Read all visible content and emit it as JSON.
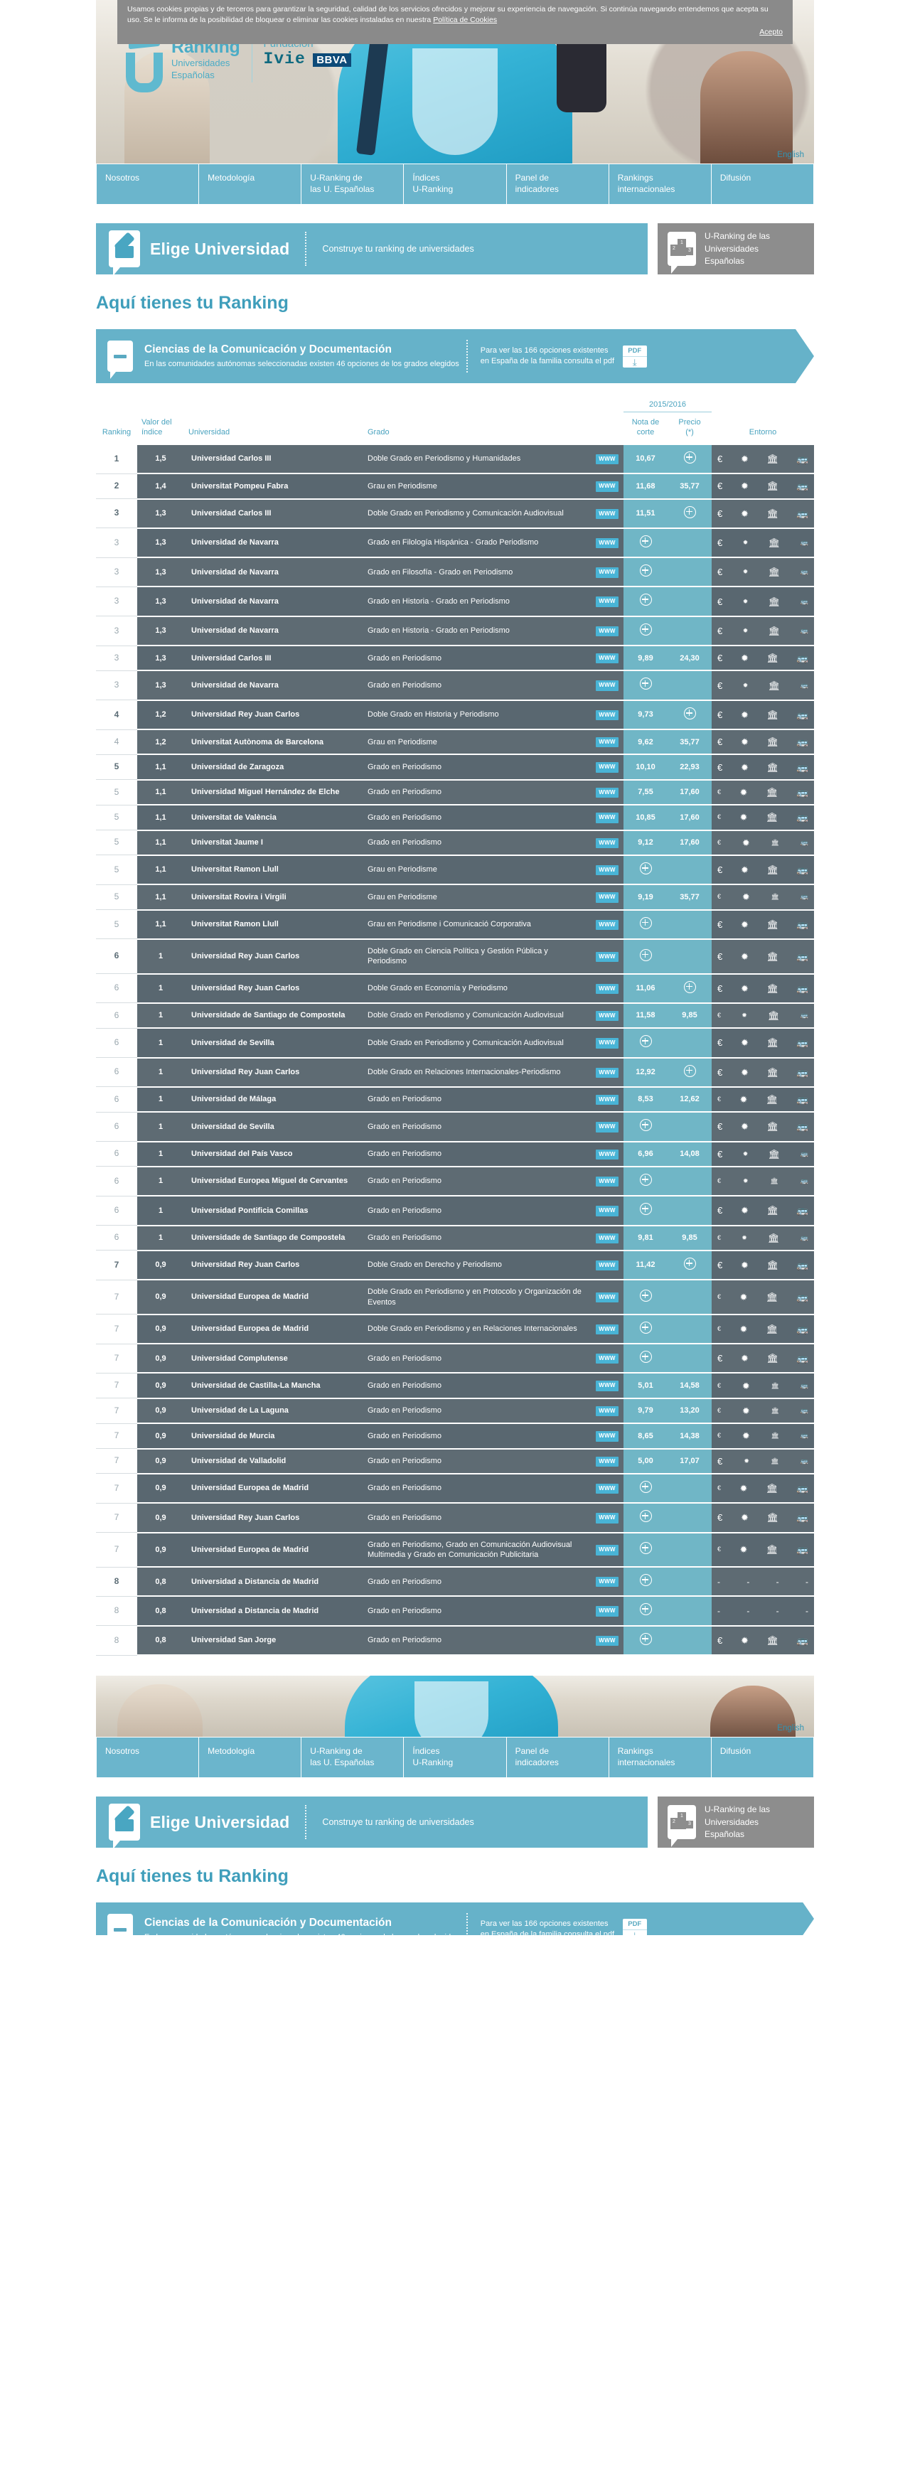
{
  "cookie": {
    "text": "Usamos cookies propias y de terceros para garantizar la seguridad, calidad de los servicios ofrecidos y mejorar su experiencia de navegación. Si continúa navegando entendemos que acepta su uso. Se le informa de la posibilidad de bloquear o eliminar las cookies instaladas en nuestra",
    "policy_link": "Política de Cookies",
    "accept": "Acepto"
  },
  "brand": {
    "logo_line1": "Ranking",
    "logo_line2": "Universidades",
    "logo_line3": "Españolas",
    "fundacion": "Fundación",
    "ivie": "Ivie",
    "bbva": "BBVA",
    "english": "English"
  },
  "nav": {
    "items": [
      "Nosotros",
      "Metodología",
      "U-Ranking de\nlas U. Españolas",
      "Índices\nU-Ranking",
      "Panel de\nindicadores",
      "Rankings\ninternacionales",
      "Difusión"
    ]
  },
  "elige": {
    "title": "Elige Universidad",
    "subtitle": "Construye tu ranking de universidades",
    "side_text": "U-Ranking de las\nUniversidades\nEspañolas",
    "podium_1": "1",
    "podium_2": "2",
    "podium_3": "3"
  },
  "heading": "Aquí tienes tu Ranking",
  "degree": {
    "name": "Ciencias de la Comunicación y Documentación",
    "description": "En las comunidades autónomas seleccionadas existen 46 opciones de los grados elegidos",
    "note": "Para ver las 166 opciones existentes en España de la familia consulta el pdf",
    "pdf_label": "PDF",
    "pdf_arrow": "⤓"
  },
  "table": {
    "year_group": "2015/2016",
    "headers": {
      "ranking": "Ranking",
      "indice": "Valor del\níndice",
      "universidad": "Universidad",
      "grado": "Grado",
      "nota": "Nota de\ncorte",
      "precio": "Precio\n(*)",
      "entorno": "Entorno"
    },
    "www_label": "WWW",
    "icons": {
      "euro": "euro-icon",
      "sun": "climate-icon",
      "museum": "culture-icon",
      "bus": "transport-icon",
      "plus": "expand-icon"
    },
    "rows": [
      {
        "rank": "1",
        "bold": true,
        "idx": "1,5",
        "uni": "Universidad Carlos III",
        "grado": "Doble Grado en Periodismo y Humanidades",
        "nota": "10,67",
        "precio": "+",
        "env": [
          "€",
          "✹",
          "🏛",
          "🚌"
        ],
        "env_sizes": [
          "lg",
          "lg",
          "lg",
          "lg"
        ]
      },
      {
        "rank": "2",
        "bold": true,
        "idx": "1,4",
        "uni": "Universitat Pompeu Fabra",
        "grado": "Grau en Periodisme",
        "nota": "11,68",
        "precio": "35,77",
        "env": [
          "€",
          "✹",
          "🏛",
          "🚌"
        ],
        "env_sizes": [
          "lg",
          "lg",
          "lg",
          "lg"
        ]
      },
      {
        "rank": "3",
        "bold": true,
        "idx": "1,3",
        "uni": "Universidad Carlos III",
        "grado": "Doble Grado en Periodismo y Comunicación Audiovisual",
        "nota": "11,51",
        "precio": "+",
        "env": [
          "€",
          "✹",
          "🏛",
          "🚌"
        ],
        "env_sizes": [
          "lg",
          "lg",
          "lg",
          "lg"
        ]
      },
      {
        "rank": "3",
        "bold": false,
        "idx": "1,3",
        "uni": "Universidad de Navarra",
        "grado": "Grado en Filología Hispánica - Grado Periodismo",
        "nota": "+",
        "precio": "",
        "env": [
          "€",
          "✹",
          "🏛",
          "🚌"
        ],
        "env_sizes": [
          "lg",
          "sm",
          "lg",
          "sm"
        ]
      },
      {
        "rank": "3",
        "bold": false,
        "idx": "1,3",
        "uni": "Universidad de Navarra",
        "grado": "Grado en Filosofía - Grado en Periodismo",
        "nota": "+",
        "precio": "",
        "env": [
          "€",
          "✹",
          "🏛",
          "🚌"
        ],
        "env_sizes": [
          "lg",
          "sm",
          "lg",
          "sm"
        ]
      },
      {
        "rank": "3",
        "bold": false,
        "idx": "1,3",
        "uni": "Universidad de Navarra",
        "grado": "Grado en Historia - Grado en Periodismo",
        "nota": "+",
        "precio": "",
        "env": [
          "€",
          "✹",
          "🏛",
          "🚌"
        ],
        "env_sizes": [
          "lg",
          "sm",
          "lg",
          "sm"
        ]
      },
      {
        "rank": "3",
        "bold": false,
        "idx": "1,3",
        "uni": "Universidad de Navarra",
        "grado": "Grado en Historia - Grado en Periodismo",
        "nota": "+",
        "precio": "",
        "env": [
          "€",
          "✹",
          "🏛",
          "🚌"
        ],
        "env_sizes": [
          "lg",
          "sm",
          "lg",
          "sm"
        ]
      },
      {
        "rank": "3",
        "bold": false,
        "idx": "1,3",
        "uni": "Universidad Carlos III",
        "grado": "Grado en Periodismo",
        "nota": "9,89",
        "precio": "24,30",
        "env": [
          "€",
          "✹",
          "🏛",
          "🚌"
        ],
        "env_sizes": [
          "lg",
          "lg",
          "lg",
          "lg"
        ]
      },
      {
        "rank": "3",
        "bold": false,
        "idx": "1,3",
        "uni": "Universidad de Navarra",
        "grado": "Grado en Periodismo",
        "nota": "+",
        "precio": "",
        "env": [
          "€",
          "✹",
          "🏛",
          "🚌"
        ],
        "env_sizes": [
          "lg",
          "sm",
          "lg",
          "sm"
        ]
      },
      {
        "rank": "4",
        "bold": true,
        "idx": "1,2",
        "uni": "Universidad Rey Juan Carlos",
        "grado": "Doble Grado en Historia y Periodismo",
        "nota": "9,73",
        "precio": "+",
        "env": [
          "€",
          "✹",
          "🏛",
          "🚌"
        ],
        "env_sizes": [
          "lg",
          "lg",
          "lg",
          "lg"
        ]
      },
      {
        "rank": "4",
        "bold": false,
        "idx": "1,2",
        "uni": "Universitat Autònoma de Barcelona",
        "grado": "Grau en Periodisme",
        "nota": "9,62",
        "precio": "35,77",
        "env": [
          "€",
          "✹",
          "🏛",
          "🚌"
        ],
        "env_sizes": [
          "lg",
          "lg",
          "lg",
          "lg"
        ]
      },
      {
        "rank": "5",
        "bold": true,
        "idx": "1,1",
        "uni": "Universidad de Zaragoza",
        "grado": "Grado en Periodismo",
        "nota": "10,10",
        "precio": "22,93",
        "env": [
          "€",
          "✹",
          "🏛",
          "🚌"
        ],
        "env_sizes": [
          "lg",
          "lg",
          "lg",
          "lg"
        ]
      },
      {
        "rank": "5",
        "bold": false,
        "idx": "1,1",
        "uni": "Universidad Miguel Hernández de Elche",
        "grado": "Grado en Periodismo",
        "nota": "7,55",
        "precio": "17,60",
        "env": [
          "€",
          "✹",
          "🏛",
          "🚌"
        ],
        "env_sizes": [
          "sm",
          "lg",
          "lg",
          "lg"
        ]
      },
      {
        "rank": "5",
        "bold": false,
        "idx": "1,1",
        "uni": "Universitat de València",
        "grado": "Grado en Periodismo",
        "nota": "10,85",
        "precio": "17,60",
        "env": [
          "€",
          "✹",
          "🏛",
          "🚌"
        ],
        "env_sizes": [
          "sm",
          "lg",
          "lg",
          "lg"
        ]
      },
      {
        "rank": "5",
        "bold": false,
        "idx": "1,1",
        "uni": "Universitat Jaume I",
        "grado": "Grado en Periodismo",
        "nota": "9,12",
        "precio": "17,60",
        "env": [
          "€",
          "✹",
          "🏛",
          "🚌"
        ],
        "env_sizes": [
          "sm",
          "lg",
          "sm",
          "sm"
        ]
      },
      {
        "rank": "5",
        "bold": false,
        "idx": "1,1",
        "uni": "Universitat Ramon Llull",
        "grado": "Grau en Periodisme",
        "nota": "+",
        "precio": "",
        "env": [
          "€",
          "✹",
          "🏛",
          "🚌"
        ],
        "env_sizes": [
          "lg",
          "lg",
          "lg",
          "lg"
        ]
      },
      {
        "rank": "5",
        "bold": false,
        "idx": "1,1",
        "uni": "Universitat Rovira i Virgili",
        "grado": "Grau en Periodisme",
        "nota": "9,19",
        "precio": "35,77",
        "env": [
          "€",
          "✹",
          "🏛",
          "🚌"
        ],
        "env_sizes": [
          "sm",
          "lg",
          "sm",
          "sm"
        ]
      },
      {
        "rank": "5",
        "bold": false,
        "idx": "1,1",
        "uni": "Universitat Ramon Llull",
        "grado": "Grau en Periodisme i Comunicació Corporativa",
        "nota": "+",
        "precio": "",
        "env": [
          "€",
          "✹",
          "🏛",
          "🚌"
        ],
        "env_sizes": [
          "lg",
          "lg",
          "lg",
          "lg"
        ]
      },
      {
        "rank": "6",
        "bold": true,
        "idx": "1",
        "uni": "Universidad Rey Juan Carlos",
        "grado": "Doble Grado en Ciencia Política y Gestión Pública y Periodismo",
        "nota": "+",
        "precio": "",
        "env": [
          "€",
          "✹",
          "🏛",
          "🚌"
        ],
        "env_sizes": [
          "lg",
          "lg",
          "lg",
          "lg"
        ]
      },
      {
        "rank": "6",
        "bold": false,
        "idx": "1",
        "uni": "Universidad Rey Juan Carlos",
        "grado": "Doble Grado en Economía y Periodismo",
        "nota": "11,06",
        "precio": "+",
        "env": [
          "€",
          "✹",
          "🏛",
          "🚌"
        ],
        "env_sizes": [
          "lg",
          "lg",
          "lg",
          "lg"
        ]
      },
      {
        "rank": "6",
        "bold": false,
        "idx": "1",
        "uni": "Universidade de Santiago de Compostela",
        "grado": "Doble Grado en Periodismo y Comunicación Audiovisual",
        "nota": "11,58",
        "precio": "9,85",
        "env": [
          "€",
          "✹",
          "🏛",
          "🚌"
        ],
        "env_sizes": [
          "sm",
          "sm",
          "lg",
          "sm"
        ]
      },
      {
        "rank": "6",
        "bold": false,
        "idx": "1",
        "uni": "Universidad de Sevilla",
        "grado": "Doble Grado en Periodismo y Comunicación Audiovisual",
        "nota": "+",
        "precio": "",
        "env": [
          "€",
          "✹",
          "🏛",
          "🚌"
        ],
        "env_sizes": [
          "lg",
          "lg",
          "lg",
          "lg"
        ]
      },
      {
        "rank": "6",
        "bold": false,
        "idx": "1",
        "uni": "Universidad Rey Juan Carlos",
        "grado": "Doble Grado en Relaciones Internacionales-Periodismo",
        "nota": "12,92",
        "precio": "+",
        "env": [
          "€",
          "✹",
          "🏛",
          "🚌"
        ],
        "env_sizes": [
          "lg",
          "lg",
          "lg",
          "lg"
        ]
      },
      {
        "rank": "6",
        "bold": false,
        "idx": "1",
        "uni": "Universidad de Málaga",
        "grado": "Grado en Periodismo",
        "nota": "8,53",
        "precio": "12,62",
        "env": [
          "€",
          "✹",
          "🏛",
          "🚌"
        ],
        "env_sizes": [
          "sm",
          "lg",
          "lg",
          "lg"
        ]
      },
      {
        "rank": "6",
        "bold": false,
        "idx": "1",
        "uni": "Universidad de Sevilla",
        "grado": "Grado en Periodismo",
        "nota": "+",
        "precio": "",
        "env": [
          "€",
          "✹",
          "🏛",
          "🚌"
        ],
        "env_sizes": [
          "lg",
          "lg",
          "lg",
          "lg"
        ]
      },
      {
        "rank": "6",
        "bold": false,
        "idx": "1",
        "uni": "Universidad del País Vasco",
        "grado": "Grado en Periodismo",
        "nota": "6,96",
        "precio": "14,08",
        "env": [
          "€",
          "✹",
          "🏛",
          "🚌"
        ],
        "env_sizes": [
          "lg",
          "sm",
          "lg",
          "sm"
        ]
      },
      {
        "rank": "6",
        "bold": false,
        "idx": "1",
        "uni": "Universidad Europea Miguel de Cervantes",
        "grado": "Grado en Periodismo",
        "nota": "+",
        "precio": "",
        "env": [
          "€",
          "✹",
          "🏛",
          "🚌"
        ],
        "env_sizes": [
          "sm",
          "sm",
          "sm",
          "sm"
        ]
      },
      {
        "rank": "6",
        "bold": false,
        "idx": "1",
        "uni": "Universidad Pontificia Comillas",
        "grado": "Grado en Periodismo",
        "nota": "+",
        "precio": "",
        "env": [
          "€",
          "✹",
          "🏛",
          "🚌"
        ],
        "env_sizes": [
          "lg",
          "lg",
          "lg",
          "lg"
        ]
      },
      {
        "rank": "6",
        "bold": false,
        "idx": "1",
        "uni": "Universidade de Santiago de Compostela",
        "grado": "Grado en Periodismo",
        "nota": "9,81",
        "precio": "9,85",
        "env": [
          "€",
          "✹",
          "🏛",
          "🚌"
        ],
        "env_sizes": [
          "sm",
          "sm",
          "lg",
          "sm"
        ]
      },
      {
        "rank": "7",
        "bold": true,
        "idx": "0,9",
        "uni": "Universidad Rey Juan Carlos",
        "grado": "Doble Grado en Derecho y Periodismo",
        "nota": "11,42",
        "precio": "+",
        "env": [
          "€",
          "✹",
          "🏛",
          "🚌"
        ],
        "env_sizes": [
          "lg",
          "lg",
          "lg",
          "lg"
        ]
      },
      {
        "rank": "7",
        "bold": false,
        "idx": "0,9",
        "uni": "Universidad Europea de Madrid",
        "grado": "Doble Grado en Periodismo y en Protocolo y Organización de Eventos",
        "nota": "+",
        "precio": "",
        "env": [
          "€",
          "✹",
          "🏛",
          "🚌"
        ],
        "env_sizes": [
          "sm",
          "lg",
          "lg",
          "lg"
        ]
      },
      {
        "rank": "7",
        "bold": false,
        "idx": "0,9",
        "uni": "Universidad Europea de Madrid",
        "grado": "Doble Grado en Periodismo y en Relaciones Internacionales",
        "nota": "+",
        "precio": "",
        "env": [
          "€",
          "✹",
          "🏛",
          "🚌"
        ],
        "env_sizes": [
          "sm",
          "lg",
          "lg",
          "lg"
        ]
      },
      {
        "rank": "7",
        "bold": false,
        "idx": "0,9",
        "uni": "Universidad Complutense",
        "grado": "Grado en Periodismo",
        "nota": "+",
        "precio": "",
        "env": [
          "€",
          "✹",
          "🏛",
          "🚌"
        ],
        "env_sizes": [
          "lg",
          "lg",
          "lg",
          "lg"
        ]
      },
      {
        "rank": "7",
        "bold": false,
        "idx": "0,9",
        "uni": "Universidad de Castilla-La Mancha",
        "grado": "Grado en Periodismo",
        "nota": "5,01",
        "precio": "14,58",
        "env": [
          "€",
          "✹",
          "🏛",
          "🚌"
        ],
        "env_sizes": [
          "sm",
          "lg",
          "sm",
          "sm"
        ]
      },
      {
        "rank": "7",
        "bold": false,
        "idx": "0,9",
        "uni": "Universidad de La Laguna",
        "grado": "Grado en Periodismo",
        "nota": "9,79",
        "precio": "13,20",
        "env": [
          "€",
          "✹",
          "🏛",
          "🚌"
        ],
        "env_sizes": [
          "sm",
          "lg",
          "sm",
          "sm"
        ]
      },
      {
        "rank": "7",
        "bold": false,
        "idx": "0,9",
        "uni": "Universidad de Murcia",
        "grado": "Grado en Periodismo",
        "nota": "8,65",
        "precio": "14,38",
        "env": [
          "€",
          "✹",
          "🏛",
          "🚌"
        ],
        "env_sizes": [
          "sm",
          "lg",
          "sm",
          "sm"
        ]
      },
      {
        "rank": "7",
        "bold": false,
        "idx": "0,9",
        "uni": "Universidad de Valladolid",
        "grado": "Grado en Periodismo",
        "nota": "5,00",
        "precio": "17,07",
        "env": [
          "€",
          "✹",
          "🏛",
          "🚌"
        ],
        "env_sizes": [
          "lg",
          "sm",
          "sm",
          "sm"
        ]
      },
      {
        "rank": "7",
        "bold": false,
        "idx": "0,9",
        "uni": "Universidad Europea de Madrid",
        "grado": "Grado en Periodismo",
        "nota": "+",
        "precio": "",
        "env": [
          "€",
          "✹",
          "🏛",
          "🚌"
        ],
        "env_sizes": [
          "sm",
          "lg",
          "lg",
          "lg"
        ]
      },
      {
        "rank": "7",
        "bold": false,
        "idx": "0,9",
        "uni": "Universidad Rey Juan Carlos",
        "grado": "Grado en Periodismo",
        "nota": "+",
        "precio": "",
        "env": [
          "€",
          "✹",
          "🏛",
          "🚌"
        ],
        "env_sizes": [
          "lg",
          "lg",
          "lg",
          "lg"
        ]
      },
      {
        "rank": "7",
        "bold": false,
        "idx": "0,9",
        "uni": "Universidad Europea de Madrid",
        "grado": "Grado en Periodismo, Grado en Comunicación Audiovisual Multimedia y Grado en Comunicación Publicitaria",
        "nota": "+",
        "precio": "",
        "env": [
          "€",
          "✹",
          "🏛",
          "🚌"
        ],
        "env_sizes": [
          "sm",
          "lg",
          "lg",
          "lg"
        ]
      },
      {
        "rank": "8",
        "bold": true,
        "idx": "0,8",
        "uni": "Universidad a Distancia de Madrid",
        "grado": "Grado en Periodismo",
        "nota": "+",
        "precio": "",
        "env": [
          "-",
          "-",
          "-",
          "-"
        ],
        "env_sizes": [
          "dash",
          "dash",
          "dash",
          "dash"
        ]
      },
      {
        "rank": "8",
        "bold": false,
        "idx": "0,8",
        "uni": "Universidad a Distancia de Madrid",
        "grado": "Grado en Periodismo",
        "nota": "+",
        "precio": "",
        "env": [
          "-",
          "-",
          "-",
          "-"
        ],
        "env_sizes": [
          "dash",
          "dash",
          "dash",
          "dash"
        ]
      },
      {
        "rank": "8",
        "bold": false,
        "idx": "0,8",
        "uni": "Universidad San Jorge",
        "grado": "Grado en Periodismo",
        "nota": "+",
        "precio": "",
        "env": [
          "€",
          "✹",
          "🏛",
          "🚌"
        ],
        "env_sizes": [
          "lg",
          "lg",
          "lg",
          "lg"
        ]
      }
    ]
  },
  "colors": {
    "accent": "#4aa3bf",
    "banner": "#66b2c9",
    "row": "#5e6b73",
    "highlight": "#70b6c6",
    "www": "#49b4d6",
    "grey_box": "#8d8d8d"
  }
}
